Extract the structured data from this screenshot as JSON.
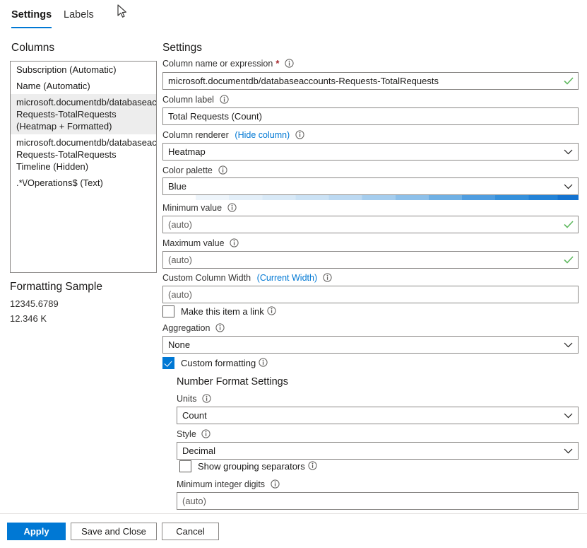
{
  "tabs": [
    {
      "id": "settings",
      "label": "Settings",
      "active": true
    },
    {
      "id": "labels",
      "label": "Labels",
      "active": false
    }
  ],
  "left": {
    "columns_heading": "Columns",
    "columns": [
      {
        "label": "Subscription (Automatic)",
        "selected": false
      },
      {
        "label": "Name (Automatic)",
        "selected": false
      },
      {
        "label": "microsoft.documentdb/databaseaccounts-Requests-TotalRequests (Heatmap + Formatted)",
        "selected": true
      },
      {
        "label": "microsoft.documentdb/databaseaccounts-Requests-TotalRequests Timeline (Hidden)",
        "selected": false
      },
      {
        "label": ".*\\/Operations$ (Text)",
        "selected": false
      }
    ],
    "formatting_sample_heading": "Formatting Sample",
    "sample_raw": "12345.6789",
    "sample_formatted": "12.346 K"
  },
  "settings": {
    "heading": "Settings",
    "column_name": {
      "label": "Column name or expression",
      "required_marker": "*",
      "value": "microsoft.documentdb/databaseaccounts-Requests-TotalRequests",
      "valid": true
    },
    "column_label": {
      "label": "Column label",
      "value": "Total Requests (Count)"
    },
    "column_renderer": {
      "label": "Column renderer",
      "sub_link": "(Hide column)",
      "value": "Heatmap"
    },
    "color_palette": {
      "label": "Color palette",
      "value": "Blue"
    },
    "minimum_value": {
      "label": "Minimum value",
      "placeholder": "(auto)",
      "valid": true
    },
    "maximum_value": {
      "label": "Maximum value",
      "placeholder": "(auto)",
      "valid": true
    },
    "custom_column_width": {
      "label": "Custom Column Width",
      "sub_link": "(Current Width)",
      "placeholder": "(auto)"
    },
    "make_link": {
      "label": "Make this item a link",
      "checked": false
    },
    "aggregation": {
      "label": "Aggregation",
      "value": "None"
    },
    "custom_formatting": {
      "label": "Custom formatting",
      "checked": true
    },
    "number_format": {
      "heading": "Number Format Settings",
      "units": {
        "label": "Units",
        "value": "Count"
      },
      "style": {
        "label": "Style",
        "value": "Decimal"
      },
      "grouping_separators": {
        "label": "Show grouping separators",
        "checked": false
      },
      "min_integer_digits": {
        "label": "Minimum integer digits",
        "placeholder": "(auto)"
      }
    }
  },
  "footer": {
    "apply": "Apply",
    "save_and_close": "Save and Close",
    "cancel": "Cancel"
  },
  "colors": {
    "accent": "#0078d4",
    "required": "#a4262c",
    "valid_check": "#5eb85e",
    "selection": "#ededed"
  }
}
